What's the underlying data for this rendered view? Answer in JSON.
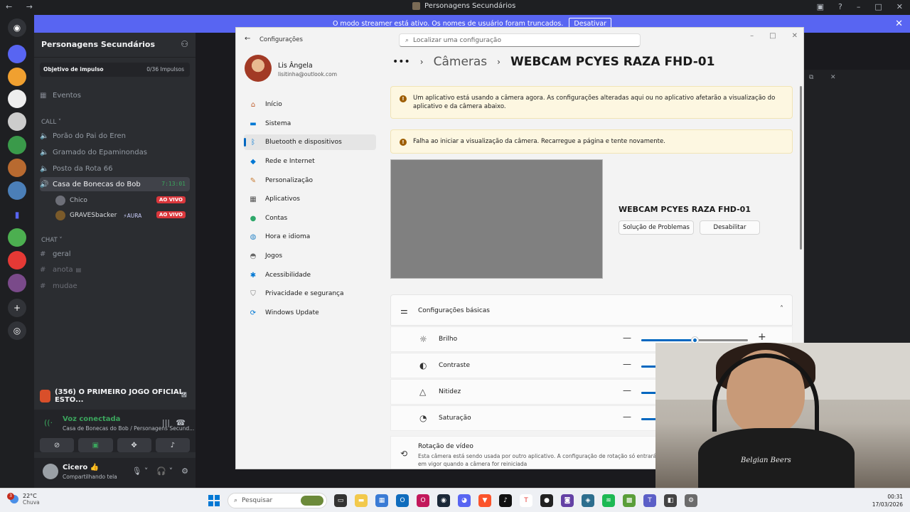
{
  "titlebar": {
    "title": "Personagens Secundários",
    "back": "←",
    "forward": "→"
  },
  "banner": {
    "text": "O modo streamer está ativo. Os nomes de usuário foram truncados.",
    "button": "Desativar"
  },
  "sidebar": {
    "server_name": "Personagens Secundários",
    "boost_label": "Objetivo de impulso",
    "boost_value": "0/36 Impulsos",
    "events": "Eventos",
    "call_category": "CALL",
    "voice_channels": [
      {
        "name": "Porão do Pai do Eren"
      },
      {
        "name": "Gramado do Epaminondas"
      },
      {
        "name": "Posto da Rota 66"
      },
      {
        "name": "Casa de Bonecas do Bob",
        "time": "7:13:01"
      }
    ],
    "members": [
      {
        "name": "Chico",
        "badge": "AO VIVO"
      },
      {
        "name": "GRAVESbacker",
        "tag": "AURA",
        "badge": "AO VIVO"
      }
    ],
    "chat_category": "CHAT",
    "text_channels": [
      {
        "name": "geral"
      },
      {
        "name": "anota"
      },
      {
        "name": "mudae"
      }
    ],
    "activity": "(356) O PRIMEIRO JOGO OFICIAL, ESTO...",
    "voice_status": "Voz conectada",
    "voice_location": "Casa de Bonecas do Bob / Personagens Secund...",
    "user_name": "Cicero",
    "user_emoji": "👍",
    "user_status": "Compartilhando tela"
  },
  "settings": {
    "app_title": "Configurações",
    "search_placeholder": "Localizar uma configuração",
    "profile_name": "Lis Ângela",
    "profile_email": "lisitinha@outlook.com",
    "nav": [
      {
        "label": "Início",
        "icon": "home-icon"
      },
      {
        "label": "Sistema",
        "icon": "system-icon"
      },
      {
        "label": "Bluetooth e dispositivos",
        "icon": "bluetooth-icon"
      },
      {
        "label": "Rede e Internet",
        "icon": "wifi-icon"
      },
      {
        "label": "Personalização",
        "icon": "brush-icon"
      },
      {
        "label": "Aplicativos",
        "icon": "apps-icon"
      },
      {
        "label": "Contas",
        "icon": "account-icon"
      },
      {
        "label": "Hora e idioma",
        "icon": "globe-icon"
      },
      {
        "label": "Jogos",
        "icon": "gamepad-icon"
      },
      {
        "label": "Acessibilidade",
        "icon": "accessibility-icon"
      },
      {
        "label": "Privacidade e segurança",
        "icon": "shield-icon"
      },
      {
        "label": "Windows Update",
        "icon": "update-icon"
      }
    ],
    "active_nav": "Bluetooth e dispositivos",
    "breadcrumb": {
      "dots": "•••",
      "parent": "Câmeras",
      "current": "WEBCAM PCYES RAZA FHD-01"
    },
    "warning1": "Um aplicativo está usando a câmera agora. As configurações alteradas aqui ou no aplicativo afetarão a visualização do aplicativo e da câmera abaixo.",
    "warning2": "Falha ao iniciar a visualização da câmera. Recarregue a página e tente novamente.",
    "camera_name": "WEBCAM PCYES RAZA FHD-01",
    "troubleshoot": "Solução de Problemas",
    "disable": "Desabilitar",
    "basic_settings": "Configurações básicas",
    "sliders": [
      {
        "label": "Brilho",
        "value": 0.5
      },
      {
        "label": "Contraste",
        "value": 0.5
      },
      {
        "label": "Nitidez",
        "value": 0.5
      },
      {
        "label": "Saturação",
        "value": 0.5
      }
    ],
    "rotation_title": "Rotação de vídeo",
    "rotation_desc": "Esta câmera está sendo usada por outro aplicativo. A configuração de rotação só entrará em vigor quando a câmera for reiniciada"
  },
  "webcam_shirt_text": "Belgian Beers",
  "taskbar": {
    "weather_temp": "22°C",
    "weather_desc": "Chuva",
    "weather_badge": "3",
    "search": "Pesquisar",
    "time": "00:31",
    "date": "17/03/2026"
  },
  "colors": {
    "discord_blurple": "#5865f2",
    "live_red": "#da373c",
    "voice_green": "#3ba55d",
    "win_accent": "#0067c0"
  }
}
